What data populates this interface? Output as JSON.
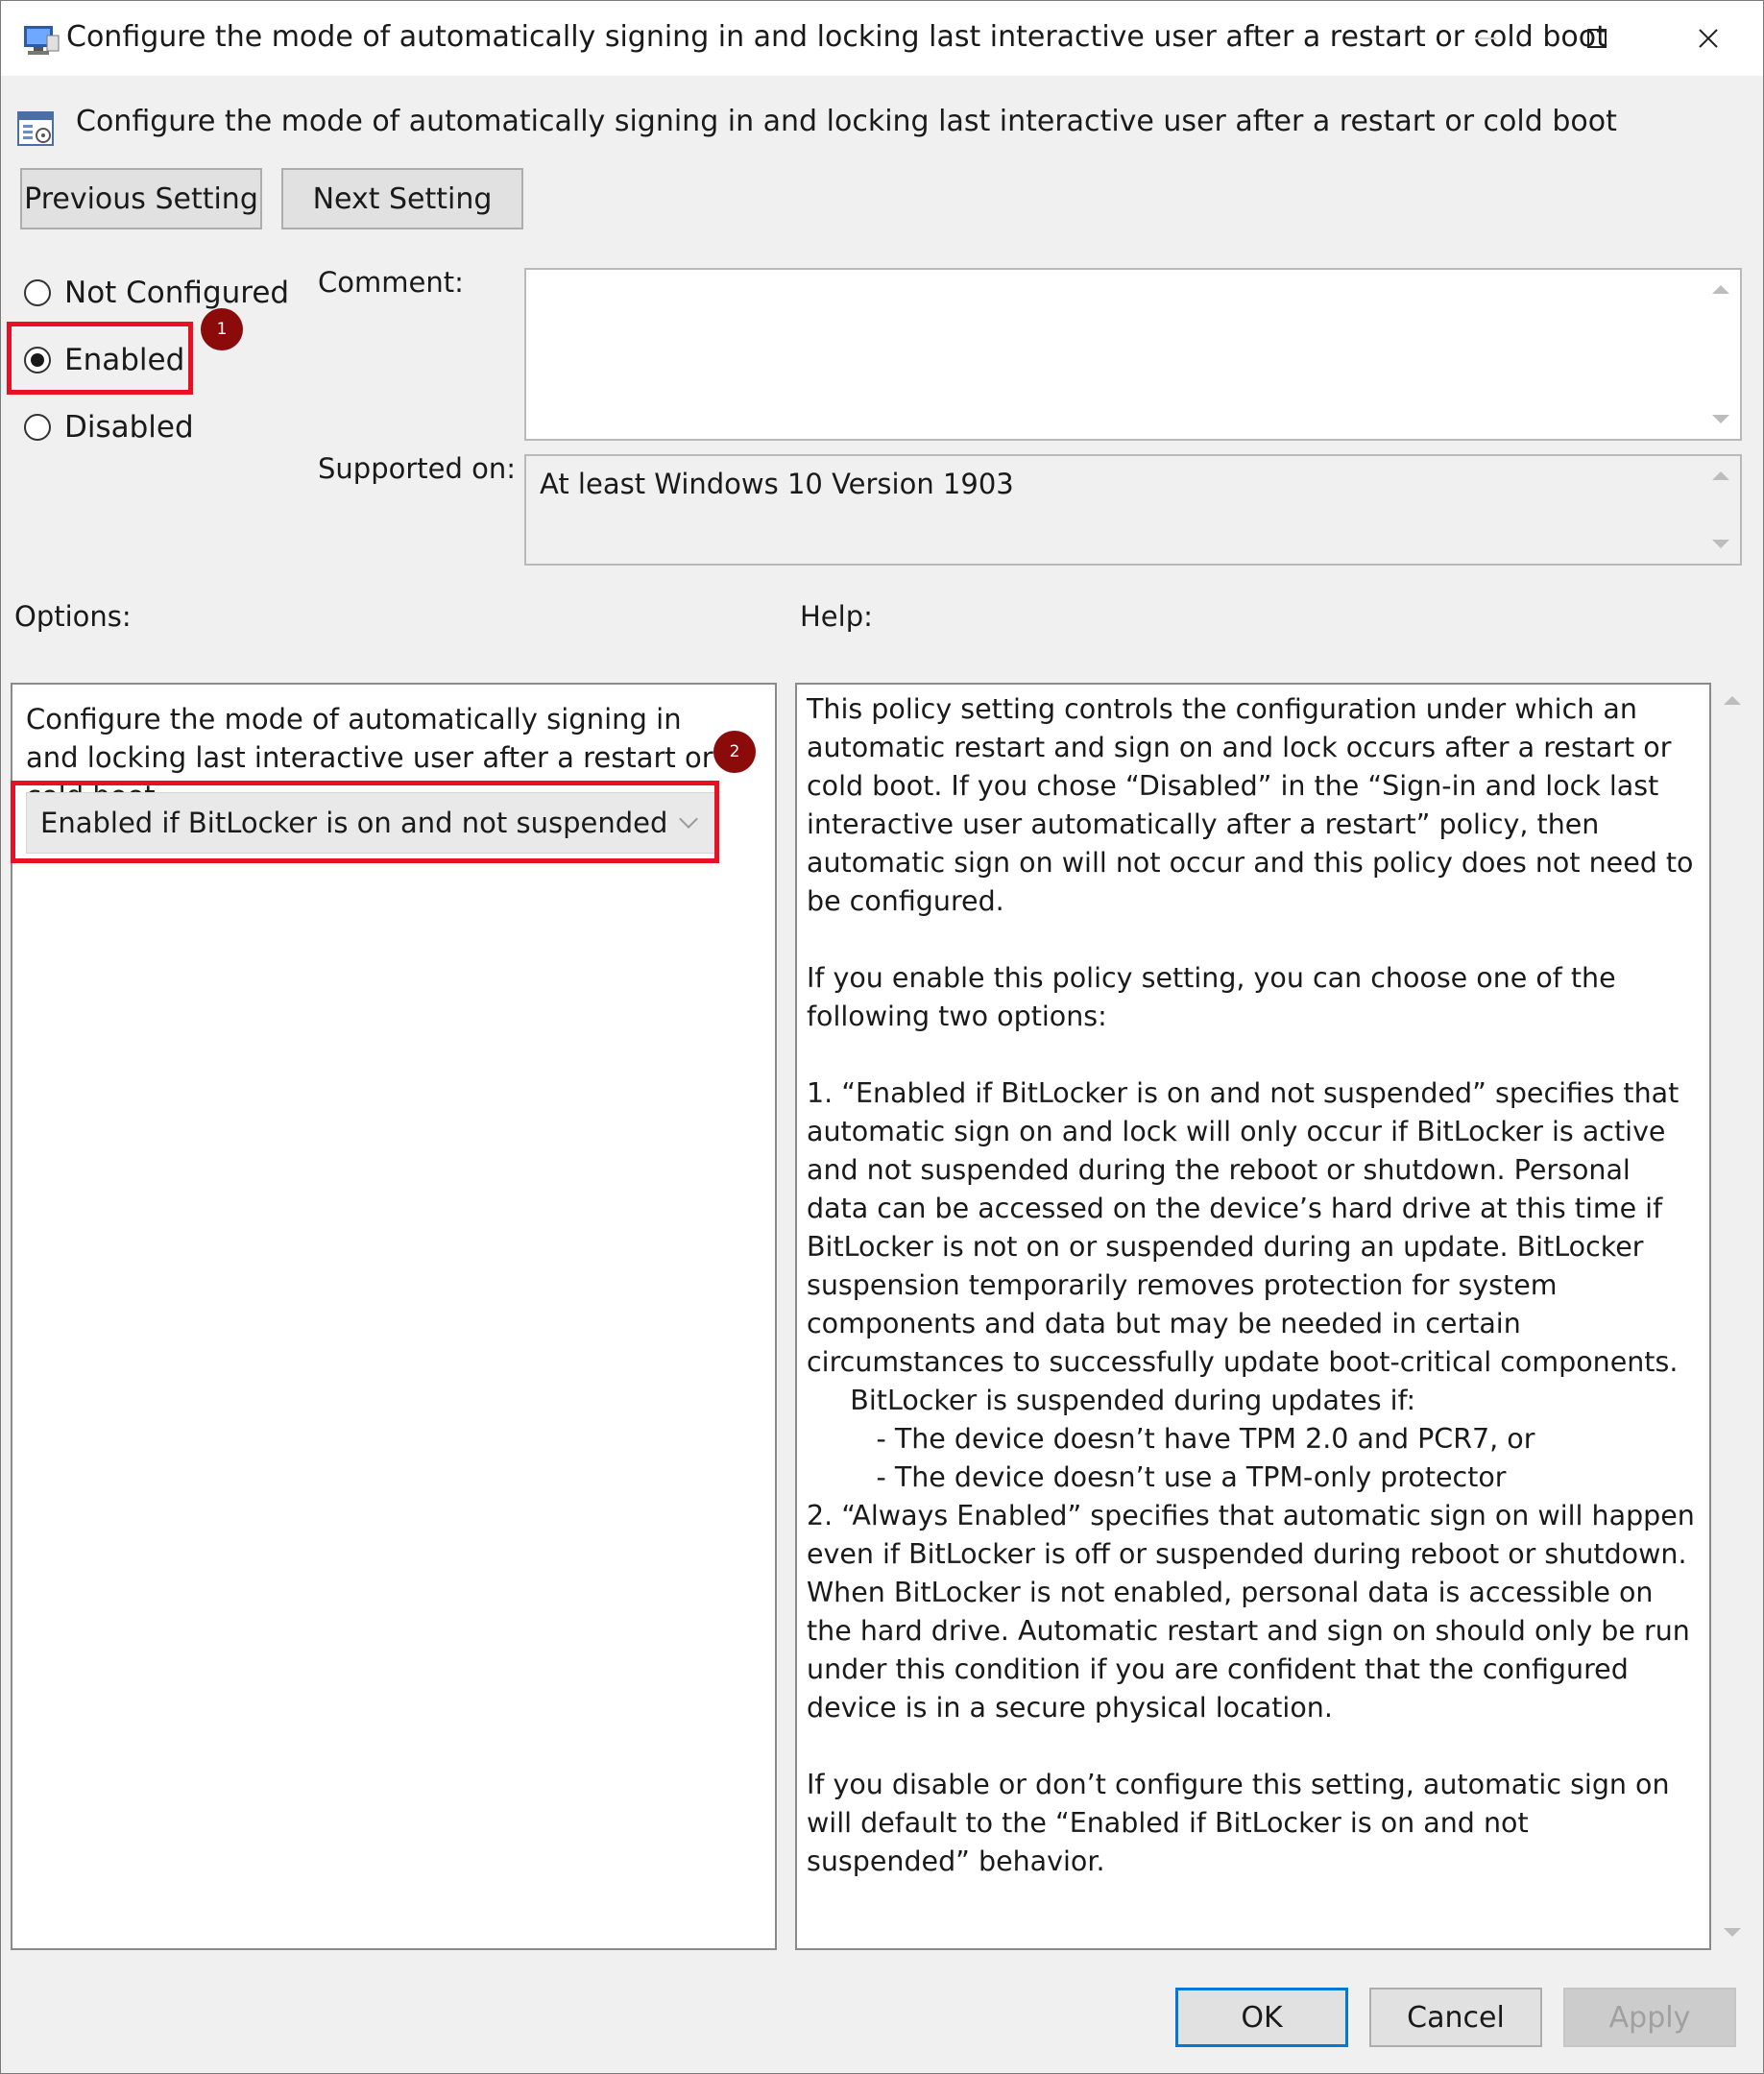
{
  "window": {
    "title": "Configure the mode of automatically signing in and locking last interactive user after a restart or cold boot",
    "controls": {
      "minimize": "–",
      "maximize": "□",
      "close": "✕"
    }
  },
  "header": {
    "title": "Configure the mode of automatically signing in and locking last interactive user after a restart or cold boot",
    "icon": "policy-settings-icon"
  },
  "nav": {
    "previous_label": "Previous Setting",
    "next_label": "Next Setting"
  },
  "state": {
    "options": [
      "Not Configured",
      "Enabled",
      "Disabled"
    ],
    "selected": "Enabled"
  },
  "annotations": {
    "badge1": "1",
    "badge2": "2",
    "color": "#e81123"
  },
  "comment": {
    "label": "Comment:",
    "value": ""
  },
  "supported": {
    "label": "Supported on:",
    "value": "At least Windows 10 Version 1903"
  },
  "options": {
    "label": "Options:",
    "description": "Configure the mode of automatically signing in and locking last interactive user after a restart or cold boot",
    "dropdown_value": "Enabled if BitLocker is on and not suspended"
  },
  "help": {
    "label": "Help:",
    "text": "This policy setting controls the configuration under which an automatic restart and sign on and lock occurs after a restart or cold boot. If you chose “Disabled” in the “Sign-in and lock last interactive user automatically after a restart” policy, then automatic sign on will not occur and this policy does not need to be configured.\n\nIf you enable this policy setting, you can choose one of the following two options:\n\n1. “Enabled if BitLocker is on and not suspended” specifies that automatic sign on and lock will only occur if BitLocker is active and not suspended during the reboot or shutdown. Personal data can be accessed on the device’s hard drive at this time if BitLocker is not on or suspended during an update. BitLocker suspension temporarily removes protection for system components and data but may be needed in certain circumstances to successfully update boot-critical components.\n     BitLocker is suspended during updates if:\n        - The device doesn’t have TPM 2.0 and PCR7, or\n        - The device doesn’t use a TPM-only protector\n2. “Always Enabled” specifies that automatic sign on will happen even if BitLocker is off or suspended during reboot or shutdown. When BitLocker is not enabled, personal data is accessible on the hard drive. Automatic restart and sign on should only be run under this condition if you are confident that the configured device is in a secure physical location.\n\nIf you disable or don’t configure this setting, automatic sign on will default to the “Enabled if BitLocker is on and not suspended” behavior."
  },
  "footer": {
    "ok_label": "OK",
    "cancel_label": "Cancel",
    "apply_label": "Apply"
  }
}
